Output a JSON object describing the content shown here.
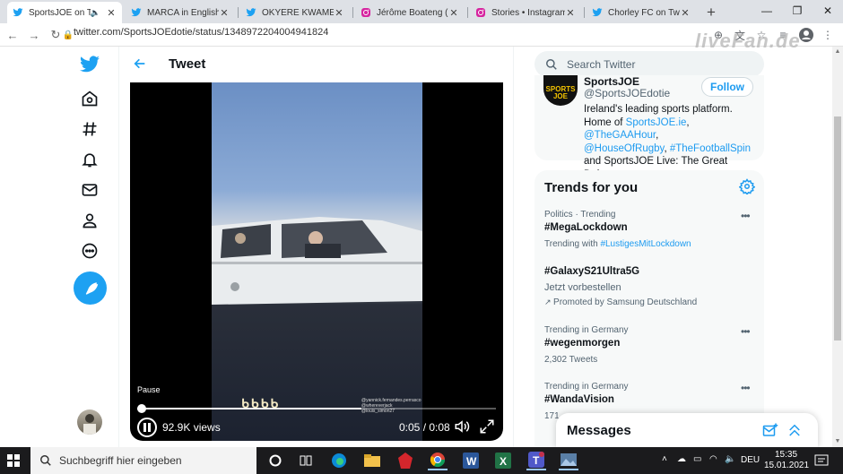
{
  "browser": {
    "tabs": [
      {
        "title": "SportsJOE on Tw",
        "icon": "twitter-icon",
        "active": true
      },
      {
        "title": "MARCA in English o",
        "icon": "twitter-icon",
        "active": false
      },
      {
        "title": "OKYERE KWAME TA",
        "icon": "twitter-icon",
        "active": false
      },
      {
        "title": "Jérôme Boateng (@",
        "icon": "instagram-icon",
        "active": false
      },
      {
        "title": "Stories • Instagram",
        "icon": "instagram-icon",
        "active": false
      },
      {
        "title": "Chorley FC on Twitte",
        "icon": "twitter-icon",
        "active": false
      }
    ],
    "new_tab": "+",
    "url": "twitter.com/SportsJOEdotie/status/1348972204004941824",
    "watermark": "liveFan.de"
  },
  "page": {
    "heading": "Tweet"
  },
  "video": {
    "tooltip": "Pause",
    "views": "92.9K views",
    "time": "0:05 / 0:08",
    "progress": 0.625,
    "caption_art": "ᑲᑲᑲᑲ",
    "tag_lines": [
      "@yannick.fernandes.perrasco",
      "@whereverjack",
      "@louis_simon27"
    ]
  },
  "search": {
    "placeholder": "Search Twitter"
  },
  "profile": {
    "avatar_text": "SPORTS JOE",
    "name": "SportsJOE",
    "handle": "@SportsJOEdotie",
    "follow_label": "Follow",
    "bio_1": "Ireland's leading sports platform.",
    "bio_2a": "Home of ",
    "bio_link1": "SportsJOE.ie",
    "bio_comma1": ", ",
    "bio_link2": "@TheGAAHour",
    "bio_comma2": ",",
    "bio_link3": "@HouseOfRugby",
    "bio_comma3": ", ",
    "bio_link4": "#TheFootballSpin",
    "bio_3": "and SportsJOE Live: The Great Debate."
  },
  "trends": {
    "title": "Trends for you",
    "items": [
      {
        "meta": "Politics · Trending",
        "name": "#MegaLockdown",
        "sub_prefix": "Trending with ",
        "sub_link": "#LustigesMitLockdown"
      },
      {
        "meta": "",
        "name": "#GalaxyS21Ultra5G",
        "sub_prefix": "Jetzt vorbestellen",
        "sub_link": ""
      },
      {
        "meta": "",
        "name": "",
        "sub_prefix": "Promoted by Samsung Deutschland",
        "sub_link": ""
      },
      {
        "meta": "Trending in Germany",
        "name": "#wegenmorgen",
        "sub_prefix": "2,302 Tweets",
        "sub_link": ""
      },
      {
        "meta": "Trending in Germany",
        "name": "#WandaVision",
        "sub_prefix": "171",
        "sub_link": ""
      }
    ],
    "more": "•••"
  },
  "messages": {
    "label": "Messages"
  },
  "taskbar": {
    "search_placeholder": "Suchbegriff hier eingeben",
    "lang": "DEU",
    "time": "15:35",
    "date": "15.01.2021"
  },
  "colors": {
    "twitter_blue": "#1da1f2",
    "link_blue": "#1d9bf0"
  }
}
